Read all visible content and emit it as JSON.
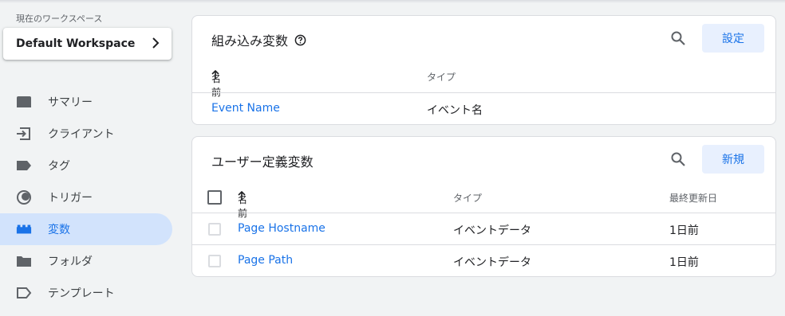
{
  "sidebar": {
    "workspace_label": "現在のワークスペース",
    "workspace_name": "Default Workspace",
    "items": [
      {
        "label": "サマリー",
        "icon": "summary-icon"
      },
      {
        "label": "クライアント",
        "icon": "client-icon"
      },
      {
        "label": "タグ",
        "icon": "tag-icon"
      },
      {
        "label": "トリガー",
        "icon": "trigger-icon"
      },
      {
        "label": "変数",
        "icon": "variables-icon",
        "active": true
      },
      {
        "label": "フォルダ",
        "icon": "folder-icon"
      },
      {
        "label": "テンプレート",
        "icon": "template-icon"
      }
    ]
  },
  "builtin": {
    "title": "組み込み変数",
    "button": "設定",
    "col_name": "名前",
    "col_type": "タイプ",
    "rows": [
      {
        "name": "Event Name",
        "type": "イベント名"
      }
    ]
  },
  "user": {
    "title": "ユーザー定義変数",
    "button": "新規",
    "col_name": "名前",
    "col_type": "タイプ",
    "col_updated": "最終更新日",
    "rows": [
      {
        "name": "Page Hostname",
        "type": "イベントデータ",
        "updated": "1日前"
      },
      {
        "name": "Page Path",
        "type": "イベントデータ",
        "updated": "1日前"
      }
    ]
  },
  "colors": {
    "accent": "#1a73e8",
    "active_bg": "#d2e3fc",
    "button_bg": "#e8f0fe"
  }
}
